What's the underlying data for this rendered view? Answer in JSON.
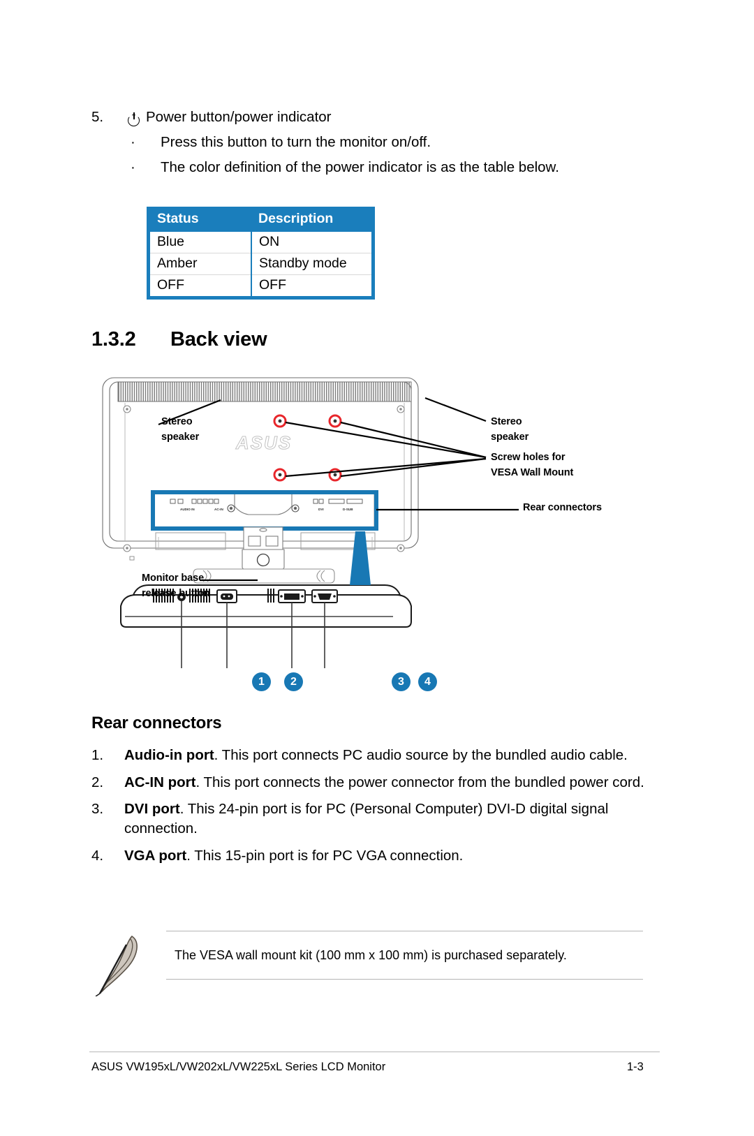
{
  "item5": {
    "number": "5.",
    "icon": "power-icon",
    "title": "Power button/power indicator",
    "bullet_marker": "·",
    "bullets": [
      "Press this button to turn the monitor on/off.",
      "The color definition of the power indicator is as the table below."
    ]
  },
  "status_table": {
    "accent_color": "#1a7ebc",
    "headers": [
      "Status",
      "Description"
    ],
    "rows": [
      [
        "Blue",
        "ON"
      ],
      [
        "Amber",
        "Standby mode"
      ],
      [
        "OFF",
        "OFF"
      ]
    ]
  },
  "section": {
    "number": "1.3.2",
    "title": "Back view"
  },
  "diagram": {
    "labels": {
      "stereo_speaker_left": "Stereo\nspeaker",
      "stereo_speaker_right": "Stereo\nspeaker",
      "vesa_screw_holes": "Screw holes for\nVESA Wall Mount",
      "rear_connectors": "Rear connectors",
      "monitor_base_release": "Monitor base\nrelease button"
    },
    "port_labels": [
      "AUDIO IN",
      "AC-IN",
      "DVI",
      "D-SUB"
    ],
    "brand": "ASUS",
    "callouts": [
      "1",
      "2",
      "3",
      "4"
    ],
    "highlight_color": "#1878b4",
    "screw_hole_color": "#e8262b"
  },
  "rear_connectors": {
    "heading": "Rear connectors",
    "items": [
      {
        "num": "1.",
        "bold": "Audio-in port",
        "rest": ". This port connects PC audio source by the bundled audio cable."
      },
      {
        "num": "2.",
        "bold": "AC-IN port",
        "rest": ". This port connects the power connector from the bundled power cord."
      },
      {
        "num": "3.",
        "bold": "DVI port",
        "rest": ". This 24-pin port is for PC (Personal Computer) DVI-D digital signal connection."
      },
      {
        "num": "4.",
        "bold": "VGA port",
        "rest": ". This 15-pin port is for PC VGA connection."
      }
    ]
  },
  "note": {
    "icon": "quill-pen-icon",
    "text": "The VESA wall mount kit (100 mm x 100 mm) is purchased separately."
  },
  "footer": {
    "left": "ASUS VW195xL/VW202xL/VW225xL Series LCD Monitor",
    "right": "1-3"
  }
}
